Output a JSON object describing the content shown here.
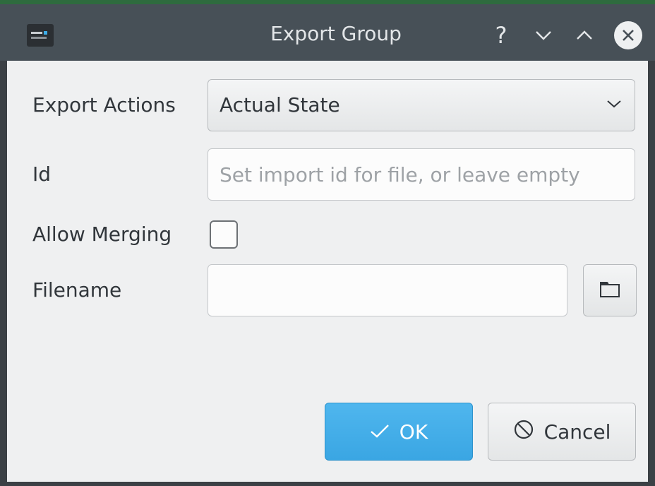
{
  "window": {
    "title": "Export Group",
    "help_glyph": "?",
    "icons": [
      "app-icon",
      "help-icon",
      "minimize-icon",
      "maximize-icon",
      "close-icon"
    ]
  },
  "form": {
    "export_actions": {
      "label": "Export Actions",
      "selected": "Actual State"
    },
    "id": {
      "label": "Id",
      "value": "",
      "placeholder": "Set import id for file, or leave empty"
    },
    "allow_merging": {
      "label": "Allow Merging",
      "checked": false
    },
    "filename": {
      "label": "Filename",
      "value": ""
    }
  },
  "buttons": {
    "ok_label": "OK",
    "cancel_label": "Cancel"
  },
  "colors": {
    "accent": "#3daee9",
    "background": "#eff0f1",
    "titlebar": "#475057",
    "text": "#31363b"
  }
}
